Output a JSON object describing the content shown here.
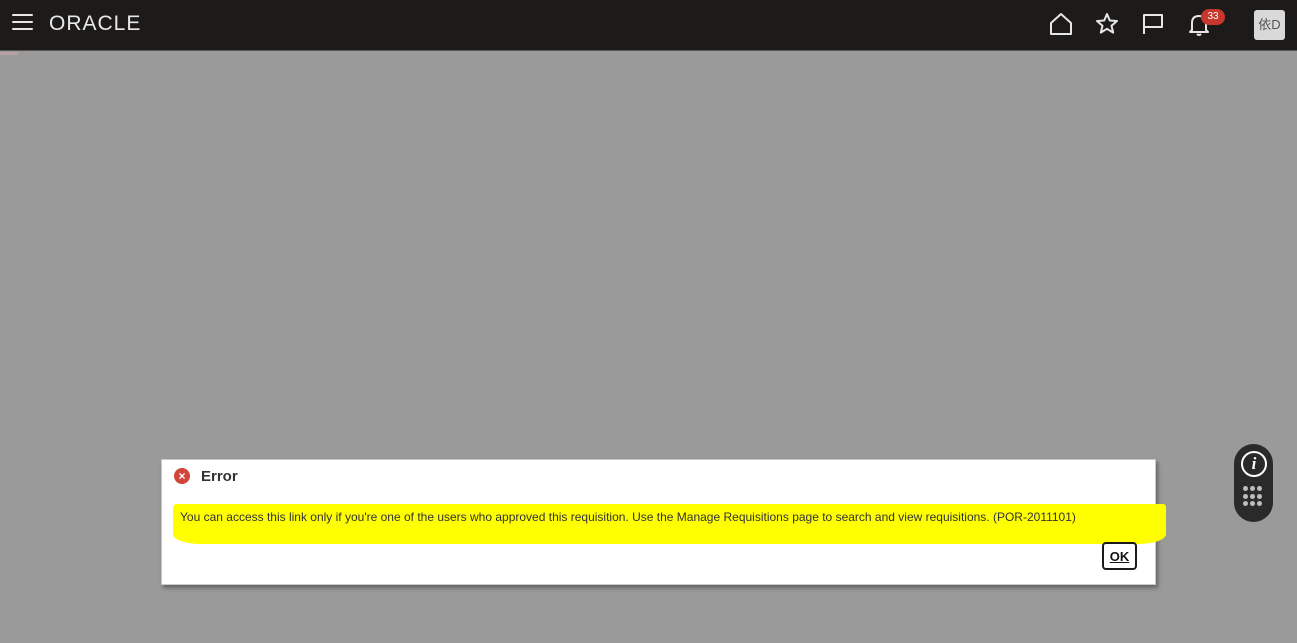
{
  "header": {
    "brand": "ORACLE",
    "icons": [
      "menu-icon",
      "home-icon",
      "favorites-icon",
      "watchlist-icon",
      "notifications-icon"
    ],
    "notification_count": "33",
    "user_initials": "依D",
    "background_color": "#1d1b19"
  },
  "dialog": {
    "title": "Error",
    "message": "You can access this link only if you're one of the users who approved this requisition. Use the Manage Requisitions page to search and view requisitions. (POR-2011101)",
    "ok_label": "OK",
    "error_icon_glyph": "×",
    "highlight_color": "#ffff00",
    "error_color": "#d1453b"
  },
  "floating_widget": {
    "info_glyph": "i",
    "icons": [
      "info-icon",
      "grid-icon"
    ]
  }
}
